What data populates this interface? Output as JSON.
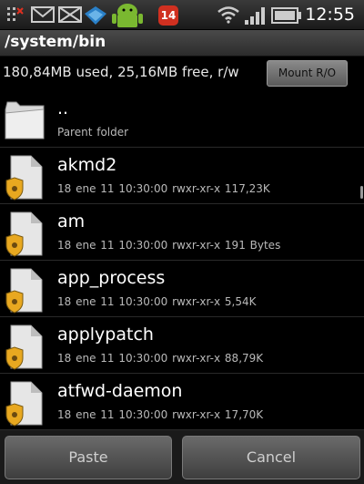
{
  "status_bar": {
    "time": "12:55",
    "badge_count": "14",
    "icons": [
      "usb-debug-icon",
      "gmail-icon",
      "email-icon",
      "market-icon",
      "android-icon",
      "calendar-badge-icon",
      "wifi-icon",
      "signal-icon",
      "battery-icon"
    ]
  },
  "path": "/system/bin",
  "storage": {
    "info": "180,84MB used, 25,16MB free, r/w",
    "mount_label": "Mount R/O"
  },
  "files": [
    {
      "name": "..",
      "meta": "Parent folder",
      "type": "folder"
    },
    {
      "name": "akmd2",
      "meta": "18 ene 11 10:30:00  rwxr-xr-x  117,23K",
      "type": "file"
    },
    {
      "name": "am",
      "meta": "18 ene 11 10:30:00  rwxr-xr-x  191 Bytes",
      "type": "file"
    },
    {
      "name": "app_process",
      "meta": "18 ene 11 10:30:00  rwxr-xr-x  5,54K",
      "type": "file"
    },
    {
      "name": "applypatch",
      "meta": "18 ene 11 10:30:00  rwxr-xr-x  88,79K",
      "type": "file"
    },
    {
      "name": "atfwd-daemon",
      "meta": "18 ene 11 10:30:00  rwxr-xr-x  17,70K",
      "type": "file"
    }
  ],
  "buttons": {
    "paste": "Paste",
    "cancel": "Cancel"
  },
  "colors": {
    "background": "#000000",
    "header": "#3a3a3a",
    "badge": "#e8b020",
    "notification_red": "#d03020"
  }
}
